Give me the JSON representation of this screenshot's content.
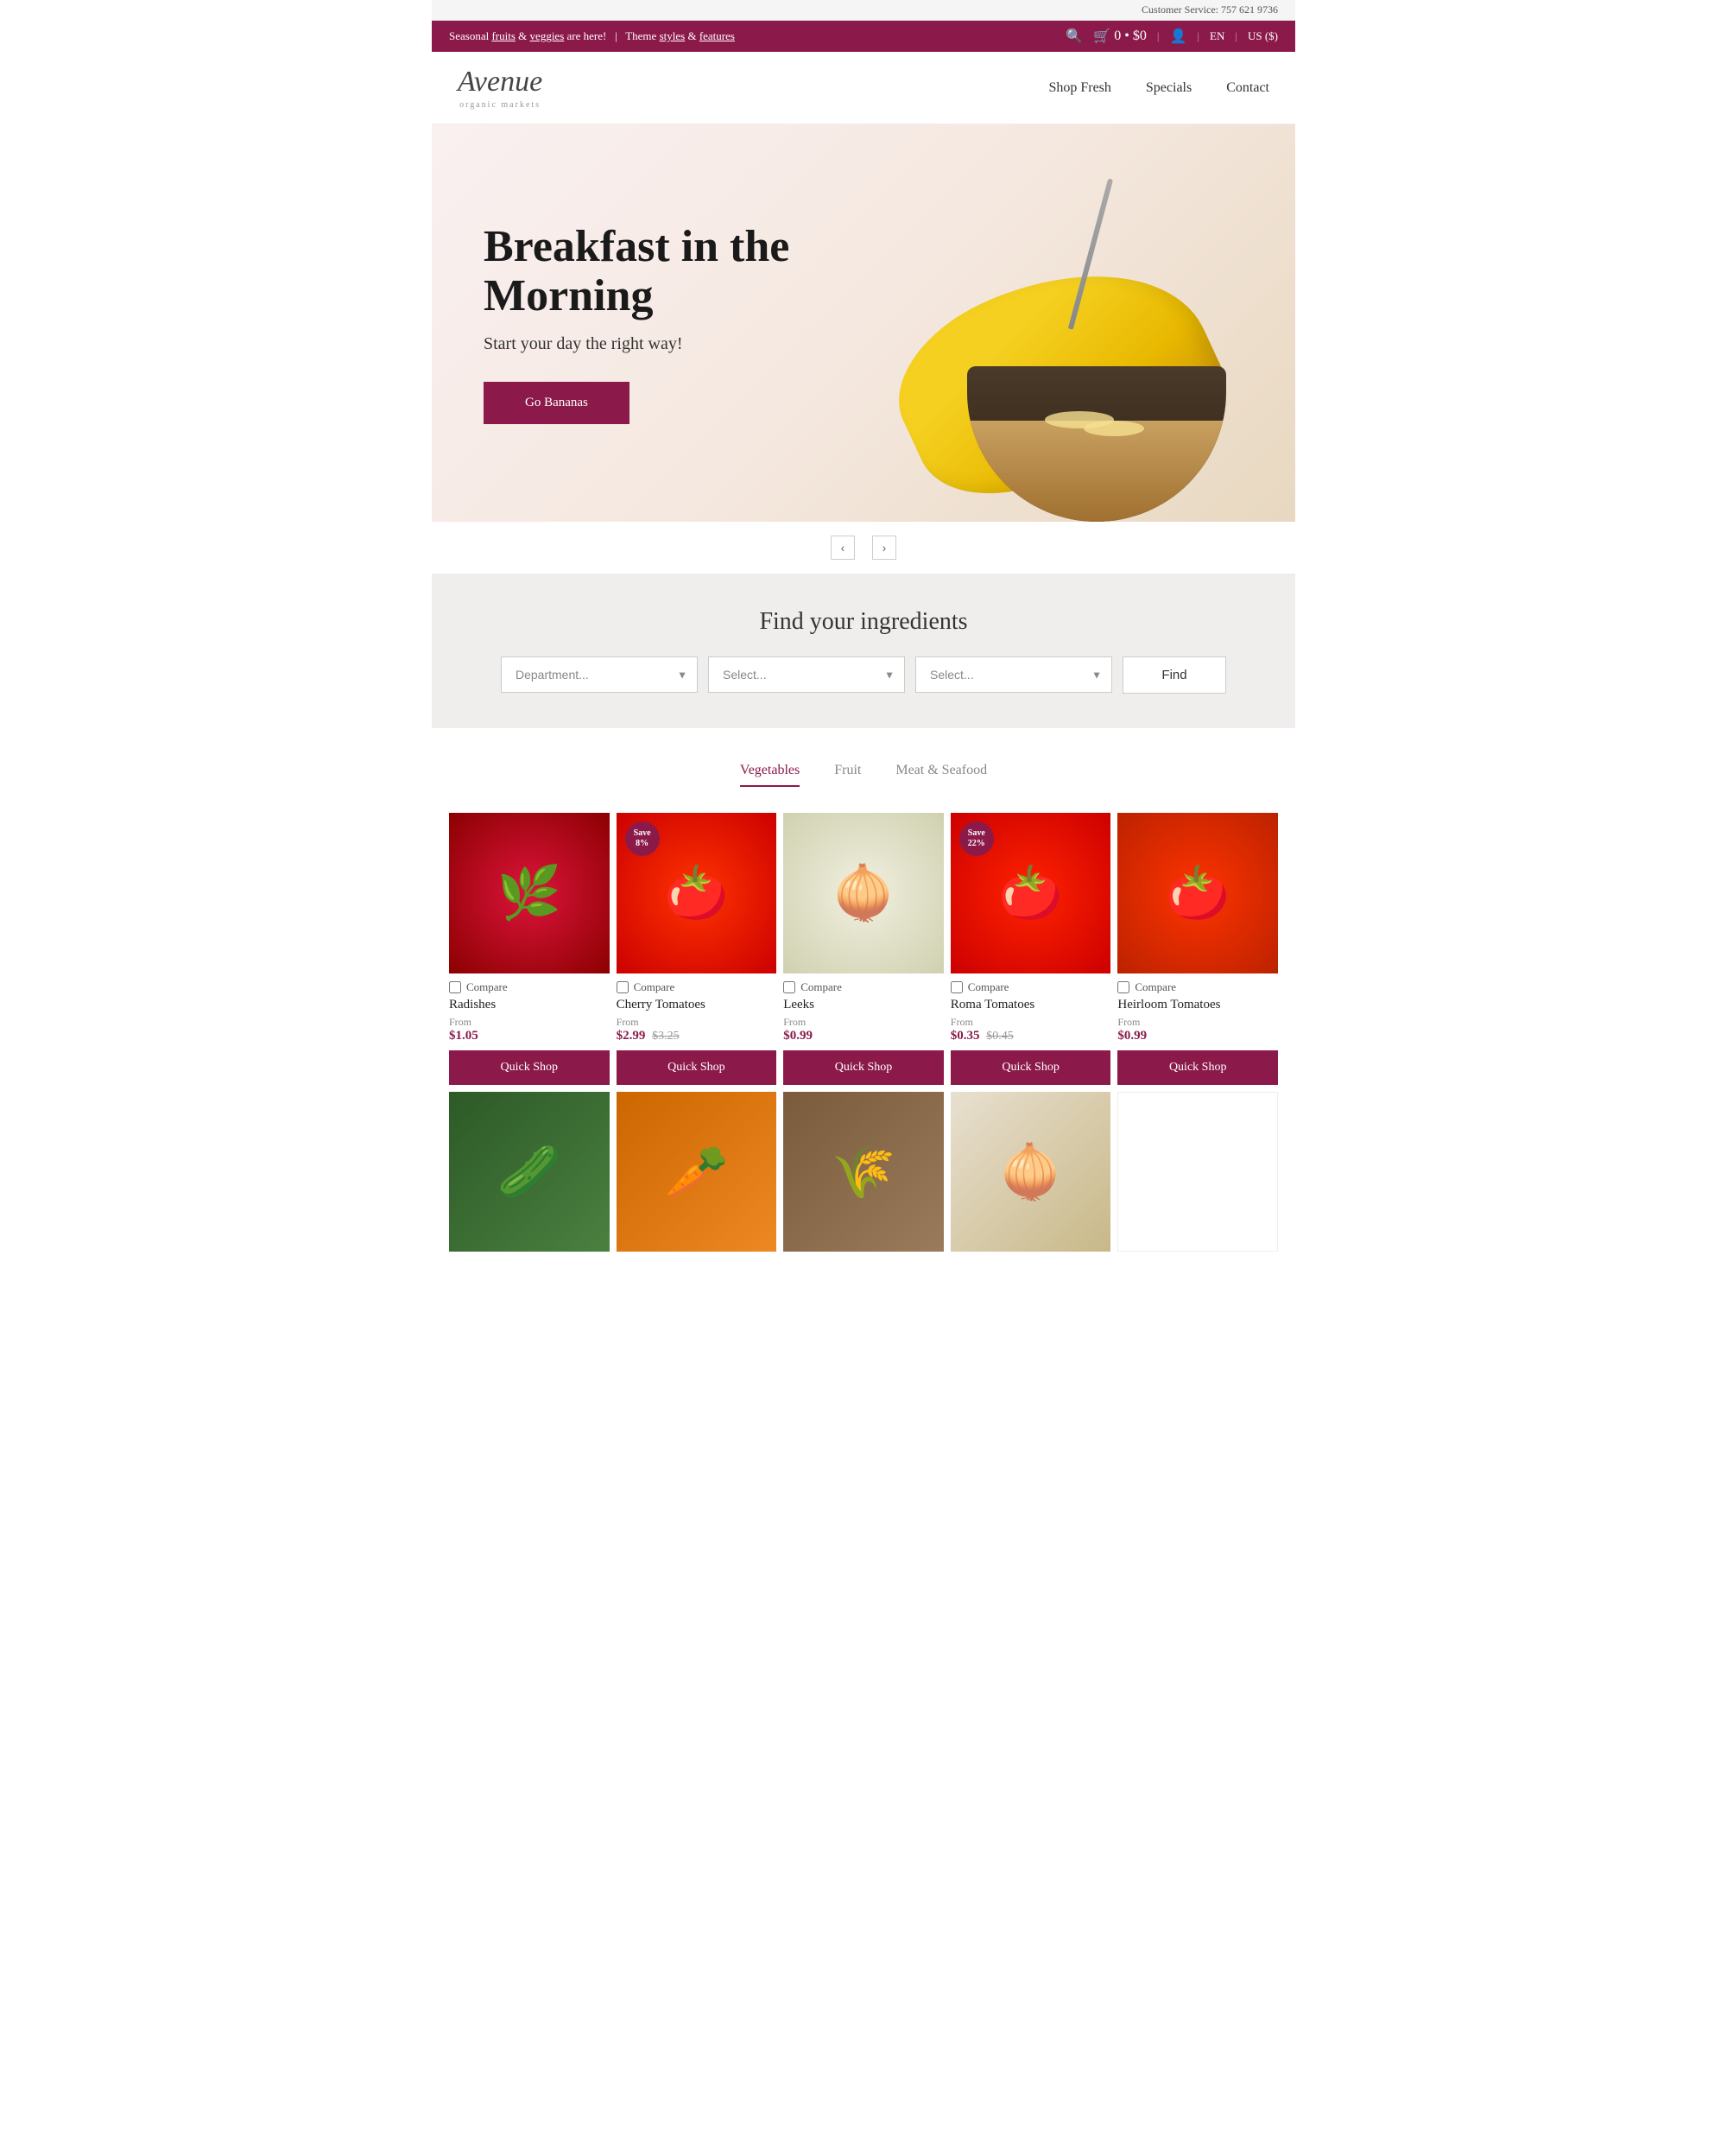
{
  "site": {
    "name": "Avenue",
    "tagline": "organic markets",
    "customer_service": "Customer Service: 757 621 9736"
  },
  "announcement": {
    "text_prefix": "Seasonal ",
    "link1": "fruits",
    "text_mid": " & ",
    "link2": "veggies",
    "text_suffix": " are here!",
    "divider": "|",
    "theme_text": "Theme ",
    "link3": "styles",
    "text_and": " & ",
    "link4": "features"
  },
  "header": {
    "nav": [
      {
        "label": "Shop Fresh",
        "id": "shop-fresh",
        "active": false
      },
      {
        "label": "Specials",
        "id": "specials",
        "active": false
      },
      {
        "label": "Contact",
        "id": "contact",
        "active": false
      }
    ],
    "cart_count": "0",
    "cart_total": "$0",
    "lang": "EN",
    "region": "US ($)"
  },
  "hero": {
    "title": "Breakfast in the Morning",
    "subtitle": "Start your day the right way!",
    "cta_label": "Go Bananas"
  },
  "find_section": {
    "title": "Find your ingredients",
    "selects": [
      {
        "placeholder": "Department...",
        "id": "dept-select"
      },
      {
        "placeholder": "Select...",
        "id": "select2"
      },
      {
        "placeholder": "Select...",
        "id": "select3"
      }
    ],
    "find_btn": "Find"
  },
  "product_section": {
    "tabs": [
      {
        "label": "Vegetables",
        "active": true
      },
      {
        "label": "Fruit",
        "active": false
      },
      {
        "label": "Meat & Seafood",
        "active": false
      }
    ],
    "products_row1": [
      {
        "name": "Radishes",
        "from_label": "From",
        "price": "$1.05",
        "original_price": null,
        "save": null,
        "emoji": "🌿",
        "color_class": "img-radishes",
        "compare": "Compare"
      },
      {
        "name": "Cherry Tomatoes",
        "from_label": "From",
        "price": "$2.99",
        "original_price": "$3.25",
        "save": "Save 8%",
        "emoji": "🍅",
        "color_class": "img-cherry",
        "compare": "Compare"
      },
      {
        "name": "Leeks",
        "from_label": "From",
        "price": "$0.99",
        "original_price": null,
        "save": null,
        "emoji": "🧅",
        "color_class": "img-leeks",
        "compare": "Compare"
      },
      {
        "name": "Roma Tomatoes",
        "from_label": "From",
        "price": "$0.35",
        "original_price": "$0.45",
        "save": "Save 22%",
        "emoji": "🍅",
        "color_class": "img-roma",
        "compare": "Compare"
      },
      {
        "name": "Heirloom Tomatoes",
        "from_label": "From",
        "price": "$0.99",
        "original_price": null,
        "save": null,
        "emoji": "🍅",
        "color_class": "img-heirloom",
        "compare": "Compare"
      }
    ],
    "quick_shop_label": "Quick Shop",
    "products_row2": [
      {
        "emoji": "🥒",
        "color": "#3d6b3d"
      },
      {
        "emoji": "🥕",
        "color": "#cc6600"
      },
      {
        "emoji": "🌾",
        "color": "#8b7355"
      },
      {
        "emoji": "🧅",
        "color": "#c8b08a"
      },
      {
        "emoji": "⬜",
        "color": "#f5f5f5"
      }
    ]
  }
}
